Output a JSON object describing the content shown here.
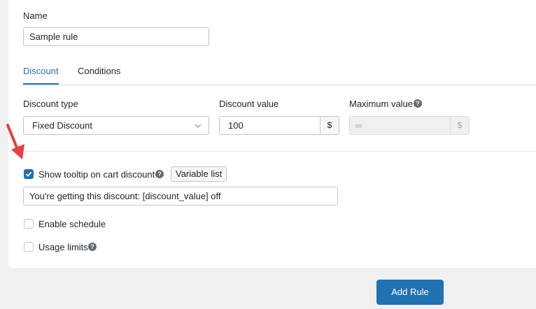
{
  "form": {
    "name_label": "Name",
    "name_value": "Sample rule",
    "tabs": [
      {
        "label": "Discount",
        "active": true
      },
      {
        "label": "Conditions",
        "active": false
      }
    ],
    "discount_type_label": "Discount type",
    "discount_type_value": "Fixed Discount",
    "discount_value_label": "Discount value",
    "discount_value": "100",
    "currency_symbol": "$",
    "maximum_value_label": "Maximum value",
    "maximum_value_placeholder": "∞",
    "tooltip_checkbox_label": "Show tooltip on cart discount",
    "tooltip_checked": true,
    "variable_list_button": "Variable list",
    "tooltip_text": "You're getting this discount: [discount_value] off",
    "schedule_label": "Enable schedule",
    "schedule_checked": false,
    "usage_limits_label": "Usage limits",
    "usage_limits_checked": false,
    "help_icon": "?",
    "add_rule_button": "Add Rule"
  },
  "colors": {
    "accent": "#2271b1",
    "annotation_arrow": "#e8403c"
  }
}
